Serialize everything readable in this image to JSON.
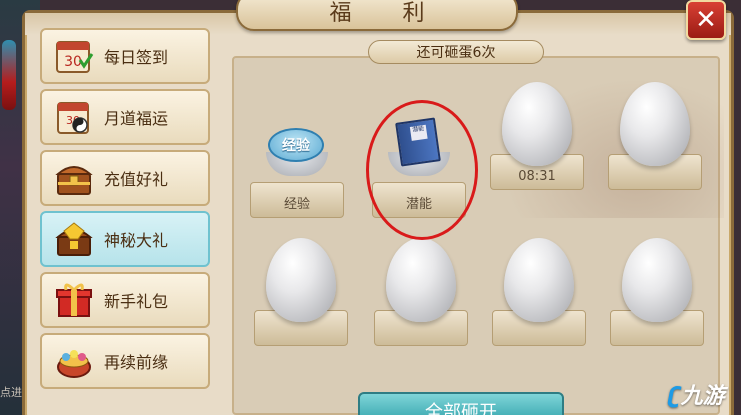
{
  "title": "福 利",
  "close_symbol": "✕",
  "sidebar": {
    "items": [
      {
        "label": "每日签到",
        "icon": "calendar-icon",
        "active": false
      },
      {
        "label": "月道福运",
        "icon": "scroll-calendar-icon",
        "active": false
      },
      {
        "label": "充值好礼",
        "icon": "treasure-chest-icon",
        "active": false
      },
      {
        "label": "神秘大礼",
        "icon": "golden-chest-icon",
        "active": true
      },
      {
        "label": "新手礼包",
        "icon": "gift-box-icon",
        "active": false
      },
      {
        "label": "再续前缘",
        "icon": "lantern-basket-icon",
        "active": false
      }
    ],
    "calendar_day": "30"
  },
  "egg_panel": {
    "remaining_text": "还可砸蛋6次",
    "slots": [
      {
        "state": "opened",
        "reward": "经验",
        "icon": "exp-badge-icon",
        "label": "经验"
      },
      {
        "state": "opened",
        "reward": "潜能",
        "icon": "book-icon",
        "label": "潜能"
      },
      {
        "state": "intact",
        "label": "08:31"
      },
      {
        "state": "intact",
        "label": ""
      },
      {
        "state": "intact",
        "label": ""
      },
      {
        "state": "intact",
        "label": ""
      },
      {
        "state": "intact",
        "label": ""
      },
      {
        "state": "intact",
        "label": ""
      }
    ],
    "exp_badge_text": "经验",
    "book_title": "潜能",
    "smash_all_label": "全部砸开"
  },
  "overlay": {
    "corner_text": "点进",
    "watermark_brand": "九游"
  },
  "colors": {
    "accent_teal": "#3aa8b0",
    "close_red": "#d84034",
    "highlight_circle": "#d91a1a",
    "frame_brown": "#8a6a3a"
  }
}
